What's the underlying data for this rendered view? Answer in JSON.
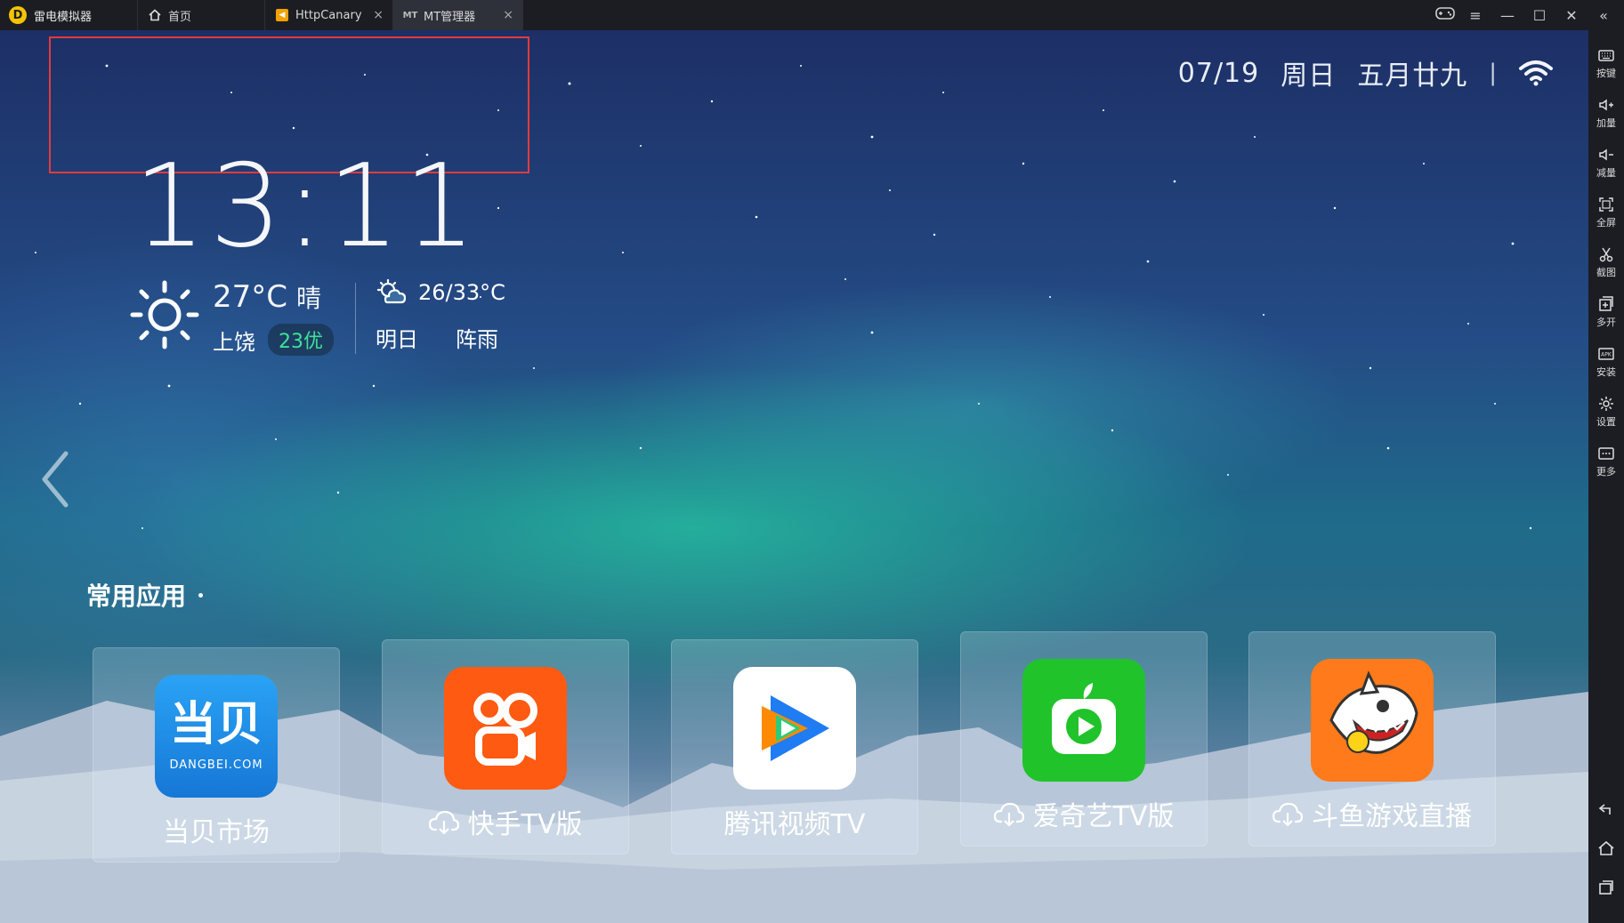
{
  "titlebar": {
    "app_name": "雷电模拟器",
    "tabs": [
      {
        "label": "首页",
        "icon": "home-icon"
      },
      {
        "label": "HttpCanary",
        "icon": "httpcanary-icon"
      },
      {
        "label": "MT管理器",
        "icon": "mt-icon"
      }
    ],
    "window_controls": [
      "gamepad-icon",
      "menu-icon",
      "minimize-icon",
      "maximize-icon",
      "close-icon",
      "collapse-icon"
    ]
  },
  "status": {
    "date": "07/19",
    "weekday": "周日",
    "lunar": "五月廿九",
    "separator": "|"
  },
  "clock": {
    "time": "13:11"
  },
  "weather": {
    "temp": "27°C",
    "condition": "晴",
    "city": "上饶",
    "aqi": "23优",
    "tomorrow_range": "26/33°C",
    "tomorrow_label": "明日",
    "tomorrow_condition": "阵雨"
  },
  "section": {
    "title": "常用应用"
  },
  "apps": [
    {
      "name": "当贝市场",
      "icon_text": "当贝",
      "icon_sub": "DANGBEI.COM",
      "installed": true
    },
    {
      "name": "快手TV版",
      "installed": false
    },
    {
      "name": "腾讯视频TV",
      "installed": true
    },
    {
      "name": "爱奇艺TV版",
      "installed": false
    },
    {
      "name": "斗鱼游戏直播",
      "installed": false
    }
  ],
  "sidebar": {
    "items": [
      "按键",
      "加量",
      "减量",
      "全屏",
      "截图",
      "多开",
      "安装",
      "设置",
      "更多"
    ],
    "bottom": [
      "back-icon",
      "home-icon",
      "recents-icon"
    ]
  },
  "colors": {
    "titlebar_bg": "#1b1d22",
    "aqi_green": "#3fe19a",
    "focus_border": "#e23b3b",
    "dangbei_blue": "#1e8fe8",
    "kuaishou_orange": "#ff5a12",
    "iqiyi_green": "#20c32a",
    "douyu_orange": "#ff7a1a"
  }
}
